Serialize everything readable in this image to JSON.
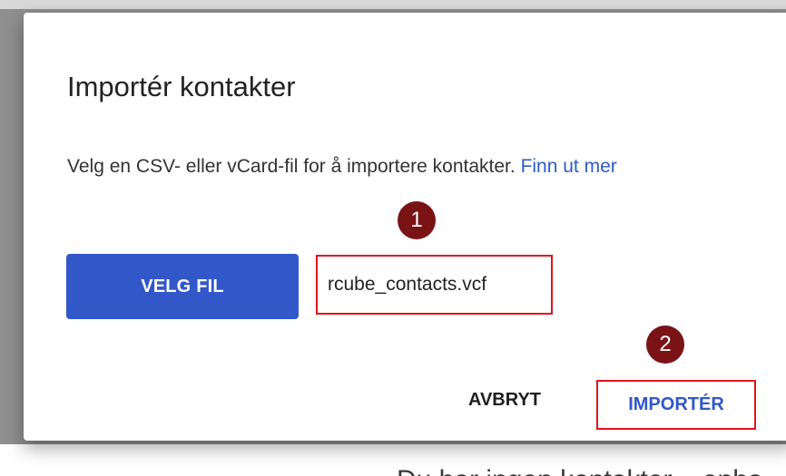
{
  "dialog": {
    "title": "Importér kontakter",
    "description": "Velg en CSV- eller vCard-fil for å importere kontakter. ",
    "link_text": "Finn ut mer",
    "choose_file_label": "VELG FIL",
    "selected_file_name": "rcube_contacts.vcf",
    "cancel_label": "AVBRYT",
    "import_label": "IMPORTÉR"
  },
  "annotations": {
    "step_1": "1",
    "step_2": "2"
  },
  "background": {
    "partial_text": "Du har ingen kontakter – enha"
  }
}
